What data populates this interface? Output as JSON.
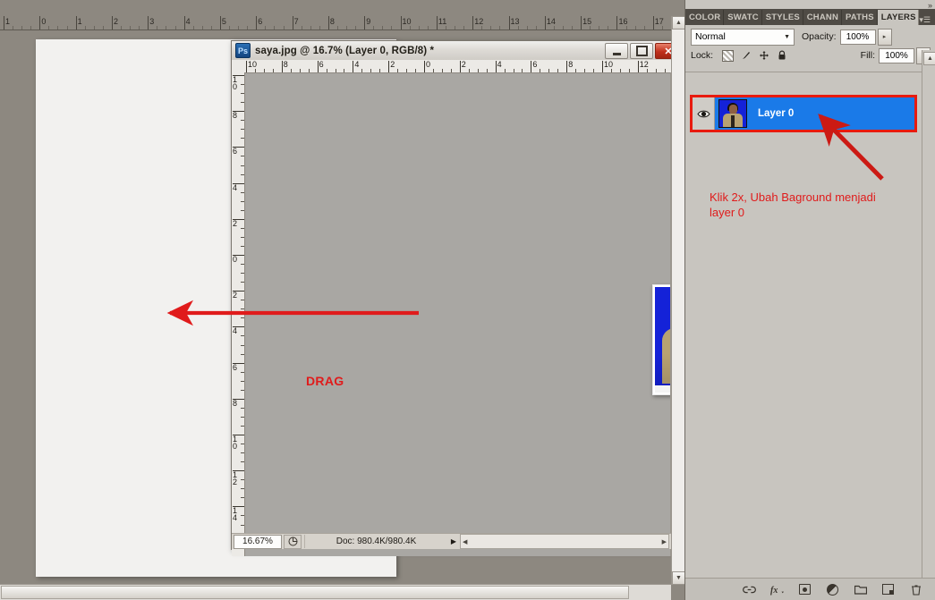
{
  "app": {
    "outer_ruler_labels": [
      "1",
      "0",
      "1",
      "2",
      "3",
      "4",
      "5",
      "6",
      "7",
      "8",
      "9",
      "10",
      "11",
      "12",
      "13",
      "14",
      "15",
      "16",
      "17"
    ]
  },
  "document_window": {
    "title": "saya.jpg @ 16.7% (Layer 0, RGB/8) *",
    "app_badge": "Ps",
    "window_buttons": {
      "minimize": "minimize-button",
      "restore": "restore-button",
      "close": "✕"
    },
    "ruler_h_labels": [
      "10",
      "8",
      "6",
      "4",
      "2",
      "0",
      "2",
      "4",
      "6",
      "8",
      "10",
      "12"
    ],
    "ruler_v_labels": [
      "10",
      "8",
      "6",
      "4",
      "2",
      "0",
      "2",
      "4",
      "6",
      "8",
      "10",
      "12",
      "14"
    ],
    "status": {
      "zoom": "16.67%",
      "doc_info": "Doc: 980.4K/980.4K",
      "doc_info_arrow": "▶",
      "scroll_left_arrow": "◀",
      "scroll_right_arrow": "▶"
    },
    "canvas": {
      "drag_label": "DRAG"
    }
  },
  "layers_panel": {
    "tabs": [
      {
        "label": "COLOR",
        "active": false
      },
      {
        "label": "SWATC",
        "active": false
      },
      {
        "label": "STYLES",
        "active": false
      },
      {
        "label": "CHANN",
        "active": false
      },
      {
        "label": "PATHS",
        "active": false
      },
      {
        "label": "LAYERS",
        "active": true
      }
    ],
    "panel_menu_icon": "▾☰",
    "collapse_icon": "»",
    "blend_mode": "Normal",
    "blend_caret": "▼",
    "opacity_label": "Opacity:",
    "opacity_value": "100%",
    "fill_label": "Fill:",
    "fill_value": "100%",
    "stepper_caret": "▸",
    "lock_label": "Lock:",
    "lock_icons": [
      "transparency-lock-icon",
      "brush-lock-icon",
      "move-lock-icon",
      "all-lock-icon"
    ],
    "lock_glyphs": {
      "brush": "✐",
      "move": "✥",
      "all": "ὑ2"
    },
    "layer": {
      "name": "Layer 0",
      "visible": true,
      "eye_glyph": "◉",
      "selected": true
    },
    "bottom_buttons": [
      {
        "name": "link-layers-button",
        "glyph": "⚭"
      },
      {
        "name": "layer-style-fx-button",
        "glyph": "fx."
      },
      {
        "name": "add-layer-mask-button",
        "glyph": "mask"
      },
      {
        "name": "new-adjustment-layer-button",
        "glyph": "circle-half"
      },
      {
        "name": "new-group-button",
        "glyph": "▱"
      },
      {
        "name": "new-layer-button",
        "glyph": "square-dot"
      },
      {
        "name": "delete-layer-button",
        "glyph": "🗑"
      }
    ]
  },
  "annotations": {
    "note_line1": "Klik 2x, Ubah Baground menjadi",
    "note_line2": "layer 0",
    "drag_text": "DRAG",
    "arrow_color": "#e01b1b",
    "highlight_color": "#e81b0f"
  },
  "scrollbars": {
    "up_arrow": "▲",
    "down_arrow": "▼",
    "left_arrow": "◀",
    "right_arrow": "▶"
  }
}
